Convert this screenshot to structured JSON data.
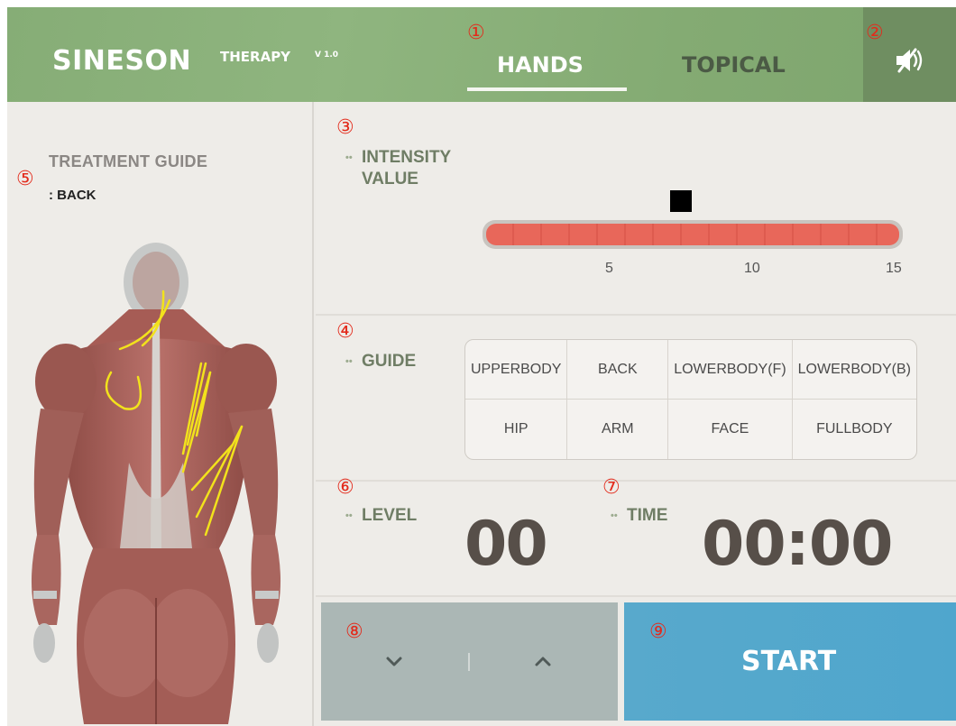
{
  "header": {
    "brand": "SINESON",
    "brand_sub": "THERAPY",
    "version": "V 1.0",
    "tabs": [
      {
        "label": "HANDS",
        "active": true
      },
      {
        "label": "TOPICAL",
        "active": false
      }
    ],
    "sound_icon": "speaker-muted-icon"
  },
  "treatment_guide": {
    "title": "TREATMENT GUIDE",
    "part": ": BACK"
  },
  "intensity": {
    "label_line1": "INTENSITY",
    "label_line2": "VALUE",
    "ticks": [
      "5",
      "10",
      "15"
    ],
    "max": 15,
    "value": 7
  },
  "guide": {
    "label": "GUIDE",
    "options": [
      [
        "UPPER",
        "BODY"
      ],
      [
        "BACK"
      ],
      [
        "LOWER",
        "BODY(F)"
      ],
      [
        "LOWER",
        "BODY(B)"
      ],
      [
        "HIP"
      ],
      [
        "ARM"
      ],
      [
        "FACE"
      ],
      [
        "FULL",
        "BODY"
      ]
    ]
  },
  "level": {
    "label": "LEVEL",
    "value": "00"
  },
  "time": {
    "label": "TIME",
    "value": "00:00"
  },
  "stepper": {
    "down_icon": "chevron-down-icon",
    "up_icon": "chevron-up-icon"
  },
  "start": {
    "label": "START"
  },
  "annotations": [
    "①",
    "②",
    "③",
    "④",
    "⑤",
    "⑥",
    "⑦",
    "⑧",
    "⑨"
  ],
  "colors": {
    "header_green": "#8fb57f",
    "start_blue": "#4fa6cd",
    "stepper_gray": "#abb7b5",
    "bar_red": "#e8675a",
    "annotation_red": "#e32b1c"
  }
}
